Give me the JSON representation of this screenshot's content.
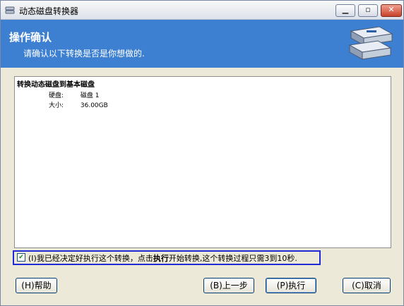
{
  "window": {
    "title": "动态磁盘转换器"
  },
  "banner": {
    "title": "操作确认",
    "subtitle": "请确认以下转换是否是你想做的."
  },
  "info": {
    "operation": "转换动态磁盘到基本磁盘",
    "rows": [
      {
        "label": "硬盘:",
        "value": "磁盘 1"
      },
      {
        "label": "大小:",
        "value": "36.00GB"
      }
    ]
  },
  "confirm": {
    "checked": true,
    "text_before": "(I)我已经决定好执行这个转换，点击",
    "text_bold": "执行",
    "text_after": "开始转换,这个转换过程只需3到10秒."
  },
  "buttons": {
    "help": "(H)帮助",
    "back": "(B)上一步",
    "execute": "(P)执行",
    "cancel": "(C)取消"
  },
  "colors": {
    "banner": "#3d7fd1",
    "confirm_border": "#1e2bd6"
  }
}
